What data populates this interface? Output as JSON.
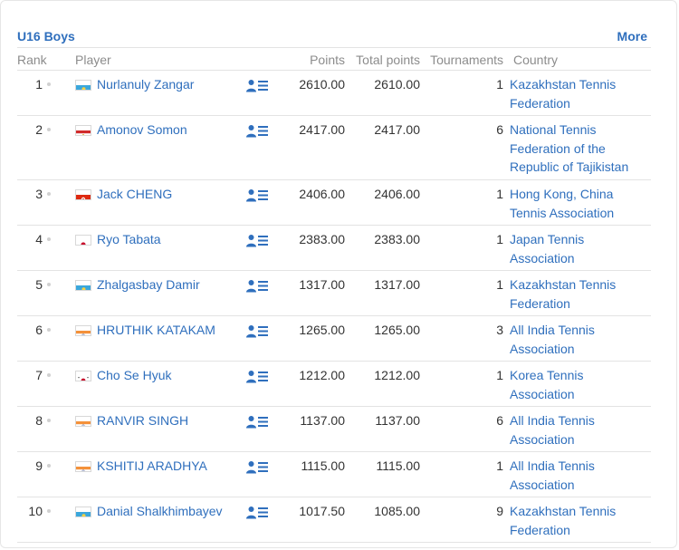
{
  "header": {
    "title": "U16 Boys",
    "more_label": "More"
  },
  "columns": {
    "rank": "Rank",
    "player": "Player",
    "points": "Points",
    "total_points": "Total points",
    "tournaments": "Tournaments",
    "country": "Country"
  },
  "rows": [
    {
      "rank": "1",
      "flag": "flag-kazakhstan-icon",
      "player": "Nurlanuly Zangar",
      "points": "2610.00",
      "total": "2610.00",
      "tournaments": "1",
      "country": "Kazakhstan Tennis Federation",
      "lines": 2
    },
    {
      "rank": "2",
      "flag": "flag-tajikistan-icon",
      "player": "Amonov Somon",
      "points": "2417.00",
      "total": "2417.00",
      "tournaments": "6",
      "country": "National Tennis Federation of the Republic of Tajikistan",
      "lines": 3
    },
    {
      "rank": "3",
      "flag": "flag-hong-kong-icon",
      "player": "Jack CHENG",
      "points": "2406.00",
      "total": "2406.00",
      "tournaments": "1",
      "country": "Hong Kong, China Tennis Association",
      "lines": 2
    },
    {
      "rank": "4",
      "flag": "flag-japan-icon",
      "player": "Ryo Tabata",
      "points": "2383.00",
      "total": "2383.00",
      "tournaments": "1",
      "country": "Japan Tennis Association",
      "lines": 2
    },
    {
      "rank": "5",
      "flag": "flag-kazakhstan-icon",
      "player": "Zhalgasbay Damir",
      "points": "1317.00",
      "total": "1317.00",
      "tournaments": "1",
      "country": "Kazakhstan Tennis Federation",
      "lines": 2
    },
    {
      "rank": "6",
      "flag": "flag-india-icon",
      "player": "HRUTHIK KATAKAM",
      "points": "1265.00",
      "total": "1265.00",
      "tournaments": "3",
      "country": "All India Tennis Association",
      "lines": 2
    },
    {
      "rank": "7",
      "flag": "flag-korea-icon",
      "player": "Cho Se Hyuk",
      "points": "1212.00",
      "total": "1212.00",
      "tournaments": "1",
      "country": "Korea Tennis Association",
      "lines": 2
    },
    {
      "rank": "8",
      "flag": "flag-india-icon",
      "player": "RANVIR SINGH",
      "points": "1137.00",
      "total": "1137.00",
      "tournaments": "6",
      "country": "All India Tennis Association",
      "lines": 2
    },
    {
      "rank": "9",
      "flag": "flag-india-icon",
      "player": "KSHITIJ ARADHYA",
      "points": "1115.00",
      "total": "1115.00",
      "tournaments": "1",
      "country": "All India Tennis Association",
      "lines": 2
    },
    {
      "rank": "10",
      "flag": "flag-kazakhstan-icon",
      "player": "Danial Shalkhimbayev",
      "points": "1017.50",
      "total": "1085.00",
      "tournaments": "9",
      "country": "Kazakhstan Tennis Federation",
      "lines": 2
    }
  ],
  "colors": {
    "link": "#2f6fbd",
    "text": "#333333",
    "muted": "#8c8c8c",
    "border": "#e3e3e3"
  },
  "icons": {
    "player_profile": "player-profile-icon",
    "rank_dot": "rank-dot-icon"
  }
}
